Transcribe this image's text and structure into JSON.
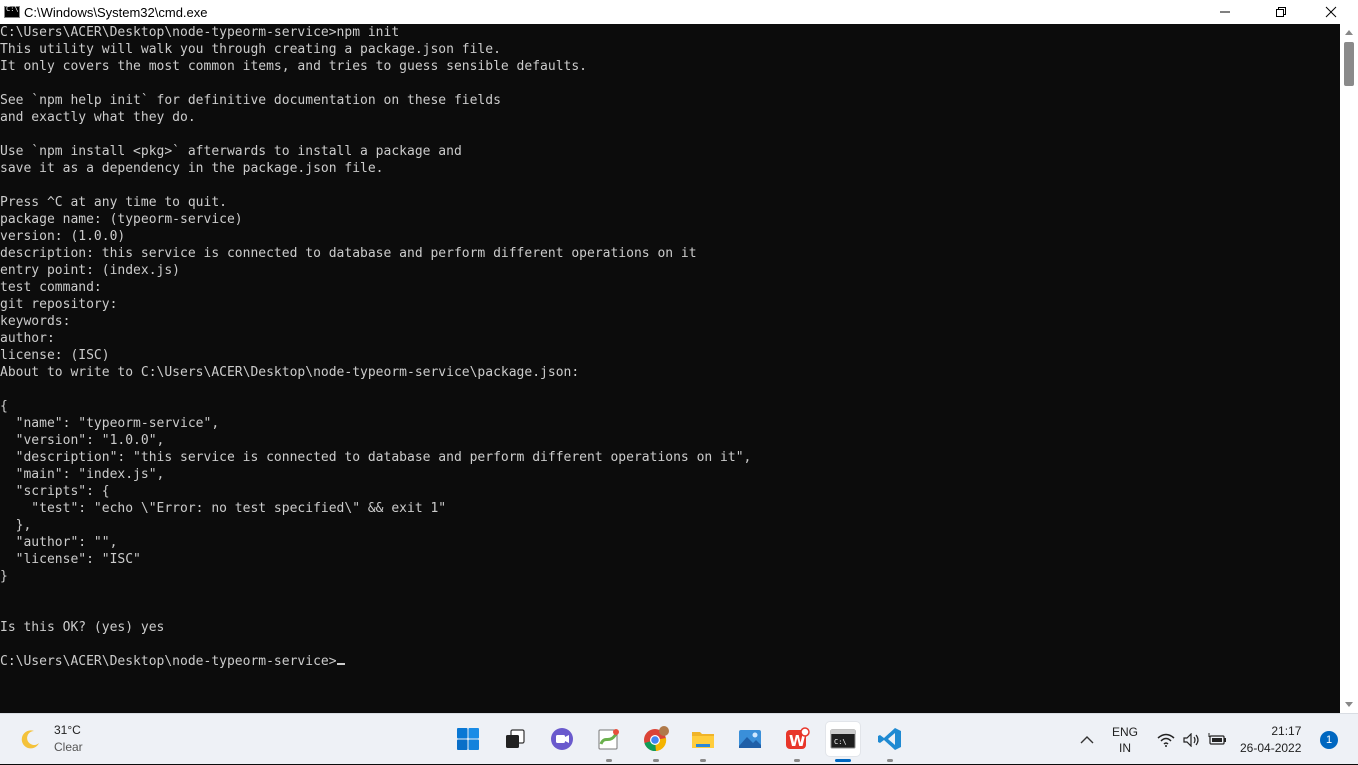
{
  "window": {
    "title": "C:\\Windows\\System32\\cmd.exe",
    "icon": "cmd-icon"
  },
  "terminal": {
    "lines": [
      "C:\\Users\\ACER\\Desktop\\node-typeorm-service>npm init",
      "This utility will walk you through creating a package.json file.",
      "It only covers the most common items, and tries to guess sensible defaults.",
      "",
      "See `npm help init` for definitive documentation on these fields",
      "and exactly what they do.",
      "",
      "Use `npm install <pkg>` afterwards to install a package and",
      "save it as a dependency in the package.json file.",
      "",
      "Press ^C at any time to quit.",
      "package name: (typeorm-service)",
      "version: (1.0.0)",
      "description: this service is connected to database and perform different operations on it",
      "entry point: (index.js)",
      "test command:",
      "git repository:",
      "keywords:",
      "author:",
      "license: (ISC)",
      "About to write to C:\\Users\\ACER\\Desktop\\node-typeorm-service\\package.json:",
      "",
      "{",
      "  \"name\": \"typeorm-service\",",
      "  \"version\": \"1.0.0\",",
      "  \"description\": \"this service is connected to database and perform different operations on it\",",
      "  \"main\": \"index.js\",",
      "  \"scripts\": {",
      "    \"test\": \"echo \\\"Error: no test specified\\\" && exit 1\"",
      "  },",
      "  \"author\": \"\",",
      "  \"license\": \"ISC\"",
      "}",
      "",
      "",
      "Is this OK? (yes) yes",
      ""
    ],
    "prompt": "C:\\Users\\ACER\\Desktop\\node-typeorm-service>",
    "text_color": "#cccccc",
    "background": "#0c0c0c"
  },
  "taskbar": {
    "weather": {
      "temp": "31°C",
      "condition": "Clear",
      "icon": "moon-icon"
    },
    "apps": [
      {
        "name": "start-icon"
      },
      {
        "name": "task-view-icon"
      },
      {
        "name": "chat-icon"
      },
      {
        "name": "notepad-plus-icon"
      },
      {
        "name": "chrome-icon"
      },
      {
        "name": "file-explorer-icon"
      },
      {
        "name": "photos-icon"
      },
      {
        "name": "wps-office-icon"
      },
      {
        "name": "terminal-icon"
      },
      {
        "name": "vscode-icon"
      }
    ],
    "tray": {
      "language_top": "ENG",
      "language_bottom": "IN",
      "time": "21:17",
      "date": "26-04-2022",
      "notification_count": "1"
    },
    "accent": "#0067c0"
  }
}
